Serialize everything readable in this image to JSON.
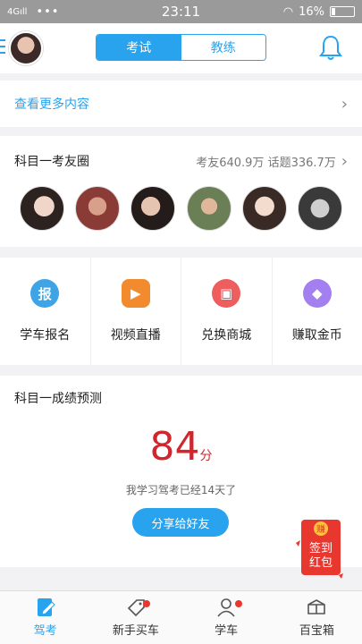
{
  "status_bar": {
    "network": "4G",
    "signal": "ıll",
    "dots": "•••",
    "time": "23:11",
    "wifi": "◠",
    "battery": "16%"
  },
  "header": {
    "tabs": [
      {
        "label": "考试",
        "active": true
      },
      {
        "label": "教练",
        "active": false
      }
    ]
  },
  "more": {
    "label": "查看更多内容"
  },
  "circle": {
    "title": "科目一考友圈",
    "stats": "考友640.9万 话题336.7万"
  },
  "features": [
    {
      "label": "学车报名",
      "icon": "报",
      "color": "#3fa4e6"
    },
    {
      "label": "视频直播",
      "icon": "▶",
      "color": "#f28b2d"
    },
    {
      "label": "兑换商城",
      "icon": "▣",
      "color": "#ee5e5e"
    },
    {
      "label": "赚取金币",
      "icon": "◆",
      "color": "#a37ff0"
    }
  ],
  "prediction": {
    "title": "科目一成绩预测",
    "score": "84",
    "unit": "分",
    "days": "我学习驾考已经14天了",
    "share": "分享给好友"
  },
  "red_packet": {
    "top": "赚",
    "line1": "签到",
    "line2": "红包"
  },
  "tabbar": [
    {
      "label": "驾考",
      "active": true,
      "dot": false
    },
    {
      "label": "新手买车",
      "active": false,
      "dot": true
    },
    {
      "label": "学车",
      "active": false,
      "dot": true
    },
    {
      "label": "百宝箱",
      "active": false,
      "dot": false
    }
  ],
  "colors": {
    "accent": "#2aa3ef",
    "score": "#d0262d",
    "badge": "#e8372f"
  }
}
